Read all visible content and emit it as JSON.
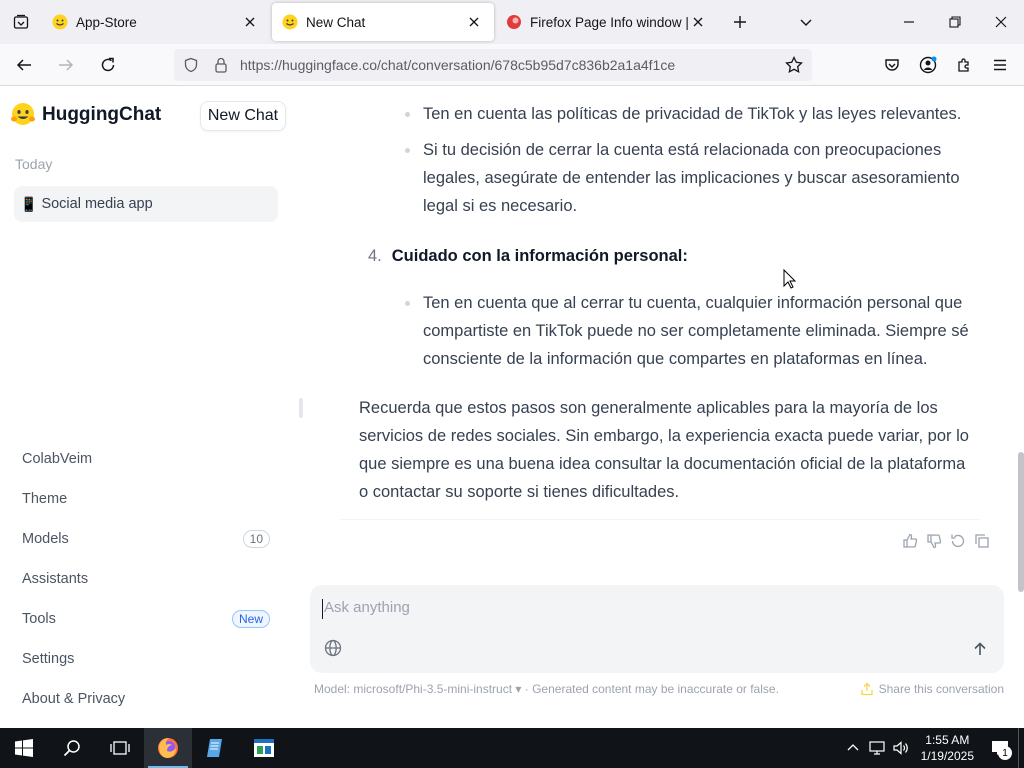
{
  "browser": {
    "tabs": [
      {
        "label": "App-Store",
        "favicon": "hugging-face-emoji",
        "active": false
      },
      {
        "label": "New Chat",
        "favicon": "hugging-face-emoji",
        "active": true
      },
      {
        "label": "Firefox Page Info window | Firef",
        "favicon": "red-circle-favicon",
        "active": false
      }
    ],
    "url_host": "https://huggingface.co",
    "url_path": "/chat/conversation/678c5b95d7c836b2a1a4f1ce"
  },
  "sidebar": {
    "brand": "HuggingChat",
    "new_chat": "New Chat",
    "section_today": "Today",
    "conversation_icon": "📱",
    "conversation": "Social media app",
    "menu": {
      "colabveim": "ColabVeim",
      "theme": "Theme",
      "models": "Models",
      "models_count": "10",
      "assistants": "Assistants",
      "tools": "Tools",
      "tools_badge": "New",
      "settings": "Settings",
      "about": "About & Privacy"
    }
  },
  "chat": {
    "bullet1": "Ten en cuenta las políticas de privacidad de TikTok y las leyes relevantes.",
    "bullet2": "Si tu decisión de cerrar la cuenta está relacionada con preocupaciones legales, asegúrate de entender las implicaciones y buscar asesoramiento legal si es necesario.",
    "item4_number": "4.",
    "item4_title": "Cuidado con la información personal:",
    "bullet3": "Ten en cuenta que al cerrar tu cuenta, cualquier información personal que compartiste en TikTok puede no ser completamente eliminada. Siempre sé consciente de la información que compartes en plataformas en línea.",
    "paragraph": "Recuerda que estos pasos son generalmente aplicables para la mayoría de los servicios de redes sociales. Sin embargo, la experiencia exacta puede variar, por lo que siempre es una buena idea consultar la documentación oficial de la plataforma o contactar su soporte si tienes dificultades."
  },
  "composer": {
    "placeholder": "Ask anything"
  },
  "footer": {
    "model_label": "Model: microsoft/Phi-3.5-mini-instruct ▾",
    "disclaimer": "· Generated content may be inaccurate or false.",
    "share": "Share this conversation"
  },
  "taskbar": {
    "time": "1:55 AM",
    "date": "1/19/2025",
    "notification_count": "1"
  },
  "colors": {
    "accent": "#ffd21e",
    "badge_blue": "#2563eb",
    "taskbar": "#101418"
  }
}
